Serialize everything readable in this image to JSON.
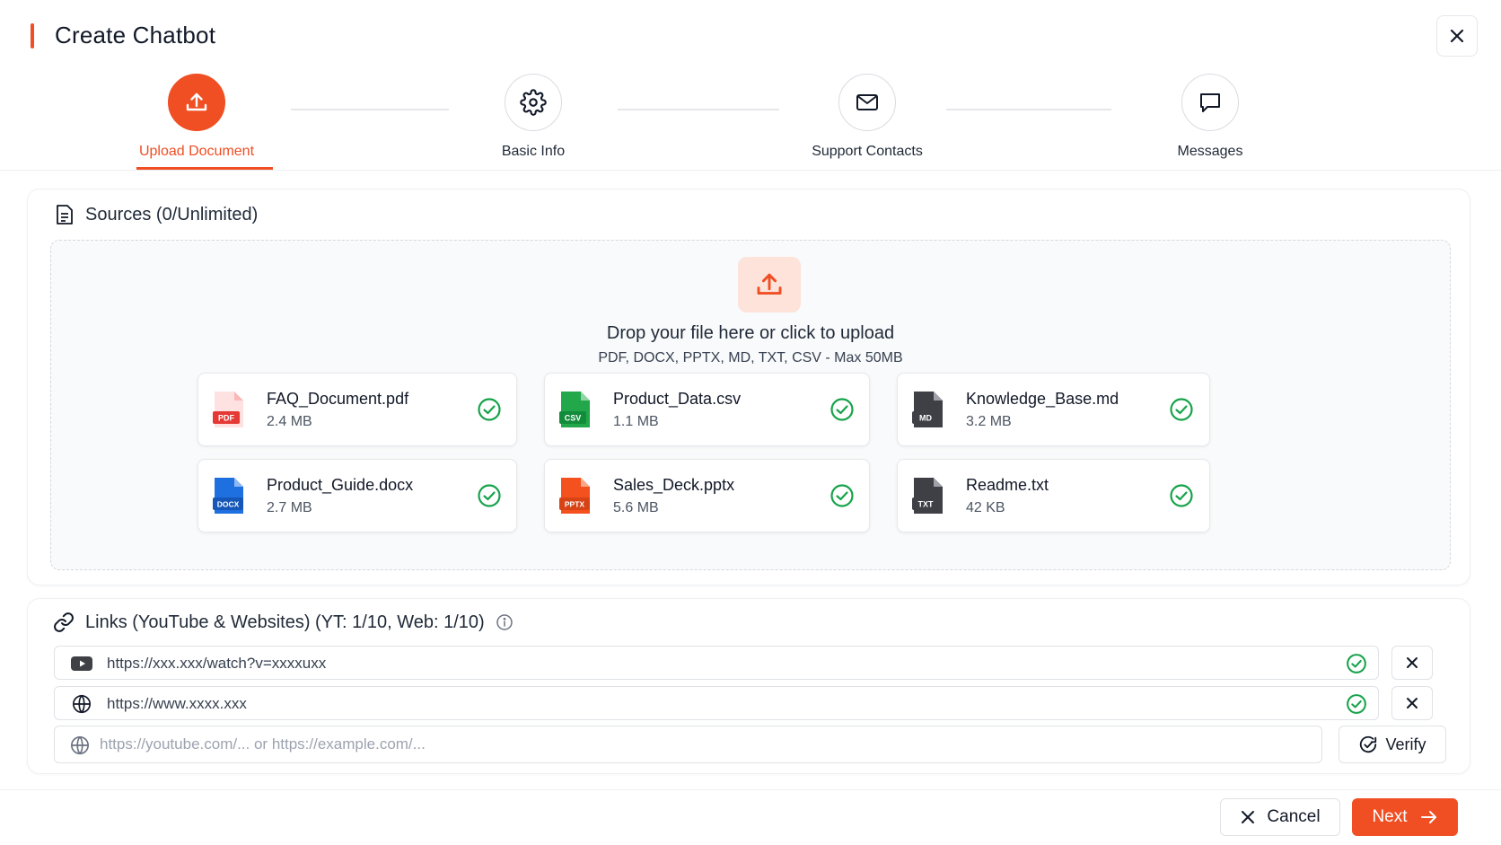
{
  "header": {
    "title": "Create Chatbot",
    "close_icon": "close-icon"
  },
  "steps": [
    {
      "label": "Upload Document",
      "icon": "upload-icon",
      "active": true
    },
    {
      "label": "Basic Info",
      "icon": "gear-icon",
      "active": false
    },
    {
      "label": "Support Contacts",
      "icon": "mail-icon",
      "active": false
    },
    {
      "label": "Messages",
      "icon": "chat-icon",
      "active": false
    }
  ],
  "sources": {
    "title": "Sources (0/Unlimited)",
    "icon": "document-list-icon",
    "dropzone": {
      "title": "Drop your file here or click to upload",
      "subtitle": "PDF, DOCX, PPTX, MD, TXT, CSV - Max 50MB"
    },
    "files": [
      {
        "name": "FAQ_Document.pdf",
        "size": "2.4 MB",
        "type": "PDF",
        "status": "uploaded"
      },
      {
        "name": "Product_Data.csv",
        "size": "1.1 MB",
        "type": "CSV",
        "status": "uploaded"
      },
      {
        "name": "Knowledge_Base.md",
        "size": "3.2 MB",
        "type": "MD",
        "status": "uploaded"
      },
      {
        "name": "Product_Guide.docx",
        "size": "2.7 MB",
        "type": "DOCX",
        "status": "uploaded"
      },
      {
        "name": "Sales_Deck.pptx",
        "size": "5.6 MB",
        "type": "PPTX",
        "status": "uploaded"
      },
      {
        "name": "Readme.txt",
        "size": "42 KB",
        "type": "TXT",
        "status": "uploaded"
      }
    ]
  },
  "links": {
    "title": "Links (YouTube & Websites) (YT: 1/10, Web: 1/10)",
    "icon": "link-icon",
    "info_icon": "info-icon",
    "items": [
      {
        "url": "https://xxx.xxx/watch?v=xxxxuxx",
        "icon": "youtube-icon",
        "verified": true
      },
      {
        "url": "https://www.xxxx.xxx",
        "icon": "globe-icon",
        "verified": true
      }
    ],
    "input": {
      "placeholder": "https://youtube.com/... or https://example.com/...",
      "value": ""
    },
    "verify_label": "Verify"
  },
  "footer": {
    "cancel_label": "Cancel",
    "next_label": "Next"
  },
  "colors": {
    "accent": "#f04e23",
    "success": "#16a34a",
    "pdf": "#e53935",
    "csv": "#16a34a",
    "docx": "#1e6fe0",
    "pptx": "#f4511e",
    "md": "#3f3f46",
    "txt": "#3f3f46"
  }
}
